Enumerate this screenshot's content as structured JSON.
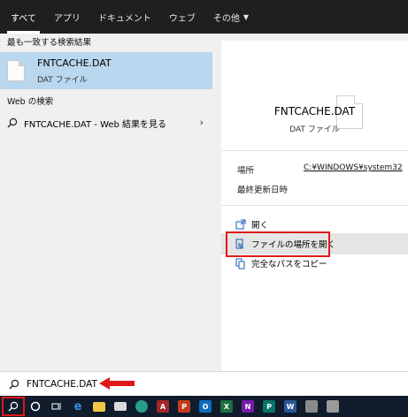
{
  "tabs": [
    {
      "label": "すべて"
    },
    {
      "label": "アプリ"
    },
    {
      "label": "ドキュメント"
    },
    {
      "label": "ウェブ"
    },
    {
      "label": "その他"
    }
  ],
  "left": {
    "best_match_heading": "最も一致する検索結果",
    "best_match": {
      "name": "FNTCACHE.DAT",
      "type": "DAT ファイル"
    },
    "web_heading": "Web の検索",
    "web_result": "FNTCACHE.DAT - Web 結果を見る"
  },
  "right": {
    "file_name": "FNTCACHE.DAT",
    "file_type": "DAT ファイル",
    "location_label": "場所",
    "location_value": "C:¥WINDOWS¥system32",
    "modified_label": "最終更新日時",
    "actions": [
      {
        "label": "開く",
        "icon": "open-icon"
      },
      {
        "label": "ファイルの場所を開く",
        "icon": "open-file-location-icon"
      },
      {
        "label": "完全なパスをコピー",
        "icon": "copy-path-icon"
      }
    ]
  },
  "search": {
    "query": "FNTCACHE.DAT"
  },
  "taskbar": {
    "items": [
      "search-icon",
      "cortana-icon",
      "task-view-icon",
      "edge-legacy-icon",
      "file-explorer-icon",
      "mail-icon",
      "edge-icon",
      "access-icon",
      "powerpoint-icon",
      "outlook-icon",
      "excel-icon",
      "onenote-icon",
      "publisher-icon",
      "word-icon",
      "store-icon",
      "app-icon"
    ]
  },
  "colors": {
    "accent": "#b9d7ee",
    "annotation": "#e01818",
    "taskbar": "#101c2c"
  }
}
